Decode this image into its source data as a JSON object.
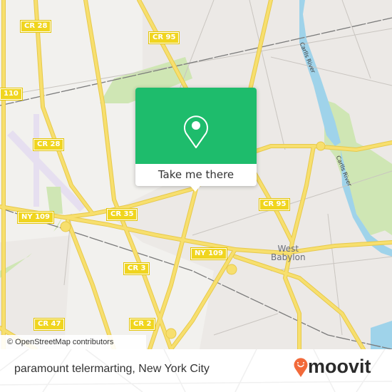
{
  "map": {
    "attribution": "© OpenStreetMap contributors",
    "place_labels": [
      {
        "id": "west-babylon",
        "line1": "West",
        "line2": "Babylon"
      }
    ],
    "road_shields": [
      {
        "id": "cr28-top",
        "label": "CR 28"
      },
      {
        "id": "cr95-top",
        "label": "CR 95"
      },
      {
        "id": "route-110",
        "label": "110"
      },
      {
        "id": "cr28-mid",
        "label": "CR 28"
      },
      {
        "id": "ny109-left",
        "label": "NY 109"
      },
      {
        "id": "cr35",
        "label": "CR 35"
      },
      {
        "id": "cr95-right",
        "label": "CR 95"
      },
      {
        "id": "ny109-center",
        "label": "NY 109"
      },
      {
        "id": "cr3",
        "label": "CR 3"
      },
      {
        "id": "cr47",
        "label": "CR 47"
      },
      {
        "id": "cr2",
        "label": "CR 2"
      }
    ],
    "water_labels": [
      {
        "id": "carlls-river-north",
        "label": "Carlls River"
      },
      {
        "id": "carlls-river-south",
        "label": "Carlls River"
      }
    ],
    "colors": {
      "land": "#f2f1ee",
      "residential": "#ece9e6",
      "park": "#cfe6b4",
      "water": "#9fd3ea",
      "road": "#f7df6e",
      "road_casing": "#e7c94a",
      "rail": "#7a7a7a",
      "airport": "#e6dff0"
    }
  },
  "popup": {
    "icon": "location-pin-icon",
    "button_label": "Take me there",
    "color": "#1ebc6c"
  },
  "footer": {
    "title": "paramount telermarting, New York City",
    "brand": "moovit",
    "brand_color": "#f26a3a"
  }
}
